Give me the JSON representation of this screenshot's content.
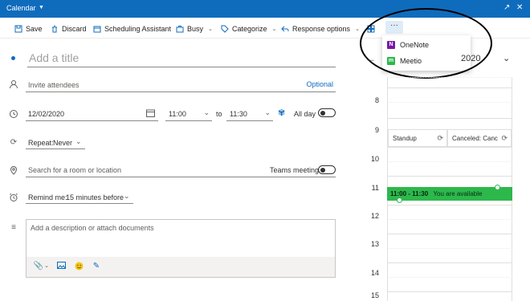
{
  "titlebar": {
    "title": "Calendar"
  },
  "toolbar": {
    "save": "Save",
    "discard": "Discard",
    "scheduling": "Scheduling Assistant",
    "busy": "Busy",
    "categorize": "Categorize",
    "response": "Response options",
    "more": "···"
  },
  "more_menu": {
    "items": [
      {
        "label": "OneNote",
        "color": "#7719aa",
        "icon": "onenote-icon"
      },
      {
        "label": "Meetio",
        "color": "#2db84c",
        "icon": "meetio-icon"
      }
    ]
  },
  "form": {
    "title_placeholder": "Add a title",
    "attendees_placeholder": "Invite attendees",
    "optional": "Optional",
    "date": "12/02/2020",
    "start_time": "11:00",
    "to": "to",
    "end_time": "11:30",
    "all_day": "All day",
    "repeat_label": "Repeat:",
    "repeat_value": "Never",
    "location_placeholder": "Search for a room or location",
    "teams_meeting": "Teams meeting",
    "remind_label": "Remind me:",
    "remind_value": "15 minutes before",
    "description_placeholder": "Add a description or attach documents"
  },
  "calendar": {
    "header_date": "2020",
    "hours": [
      "8",
      "9",
      "10",
      "11",
      "12",
      "13",
      "14",
      "15"
    ],
    "events": [
      {
        "title": "Standup"
      },
      {
        "title": "Canceled: Canc"
      }
    ],
    "new_event": {
      "time": "11:00 - 11:30",
      "status": "You are available",
      "color": "#2db84c"
    }
  },
  "colors": {
    "brand": "#0f6cbd",
    "accent_light": "#deecf9"
  }
}
